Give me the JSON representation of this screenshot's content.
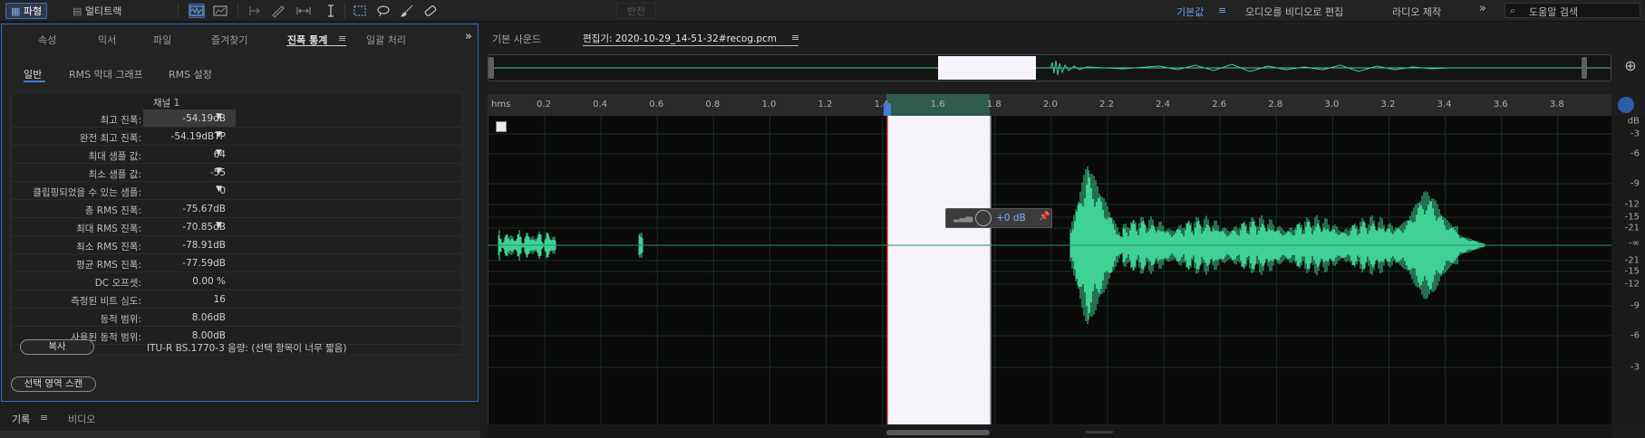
{
  "toolbar": {
    "waveform_label": "파형",
    "multitrack_label": "멀티트랙",
    "workspace_btn": "반전",
    "workspaces": [
      "기본값",
      "오디오를 비디오로 편집",
      "라디오 제작"
    ],
    "workspace_menu_icon": "≡",
    "more_icon": "»",
    "search_placeholder": "도움말 검색"
  },
  "left_panel": {
    "tabs": [
      "속성",
      "믹서",
      "파일",
      "즐겨찾기",
      "진폭 통계",
      "일괄 처리"
    ],
    "active_tab": "진폭 통계",
    "tab_menu_icon": "≡",
    "more_icon": "»",
    "subtabs": [
      "일반",
      "RMS 막대 그래프",
      "RMS 설정"
    ],
    "active_subtab": "일반",
    "channel_header": "채널 1",
    "rows": [
      {
        "label": "최고 진폭:",
        "value": "-54.19dB"
      },
      {
        "label": "완전 최고 진폭:",
        "value": "-54.19dBTP"
      },
      {
        "label": "최대 샘플 값:",
        "value": "64"
      },
      {
        "label": "최소 샘플 값:",
        "value": "-55"
      },
      {
        "label": "클립핑되었을 수 있는 샘플:",
        "value": "0"
      },
      {
        "label": "총 RMS 진폭:",
        "value": "-75.67dB"
      },
      {
        "label": "최대 RMS 진폭:",
        "value": "-70.85dB"
      },
      {
        "label": "최소 RMS 진폭:",
        "value": "-78.91dB"
      },
      {
        "label": "평균 RMS 진폭:",
        "value": "-77.59dB"
      },
      {
        "label": "DC 오프셋:",
        "value": "0.00 %"
      },
      {
        "label": "측정된 비트 심도:",
        "value": "16"
      },
      {
        "label": "동적 범위:",
        "value": "8.06dB"
      },
      {
        "label": "사용된 동적 범위:",
        "value": "8.00dB"
      }
    ],
    "copy_button": "복사",
    "loudness_text": "ITU-R BS.1770-3 음량: (선택 항목이 너무 짧음)",
    "scan_button": "선택 영역 스캔"
  },
  "bottom_tabs": {
    "history": "기록",
    "history_menu_icon": "≡",
    "video": "비디오"
  },
  "editor": {
    "tab_basic": "기본 사운드",
    "tab_editor": "편집기: 2020-10-29_14-51-32#recog.pcm",
    "tab_menu_icon": "≡",
    "ruler_unit": "hms",
    "ruler_ticks": [
      "0.2",
      "0.4",
      "0.6",
      "0.8",
      "1.0",
      "1.2",
      "1.4",
      "1.6",
      "1.8",
      "2.0",
      "2.2",
      "2.4",
      "2.6",
      "2.8",
      "3.0",
      "3.2",
      "3.4",
      "3.6",
      "3.8"
    ],
    "hud_value": "+0 dB",
    "db_labels": [
      "dB",
      "-3",
      "-6",
      "-9",
      "-12",
      "-15",
      "-21",
      "-∞",
      "-21",
      "-15",
      "-12",
      "-9",
      "-6",
      "-3"
    ]
  },
  "colors": {
    "accent": "#2f6cb4",
    "waveform": "#3fd195",
    "selection": "#f4f4fa",
    "playhead": "#c23a3a"
  }
}
